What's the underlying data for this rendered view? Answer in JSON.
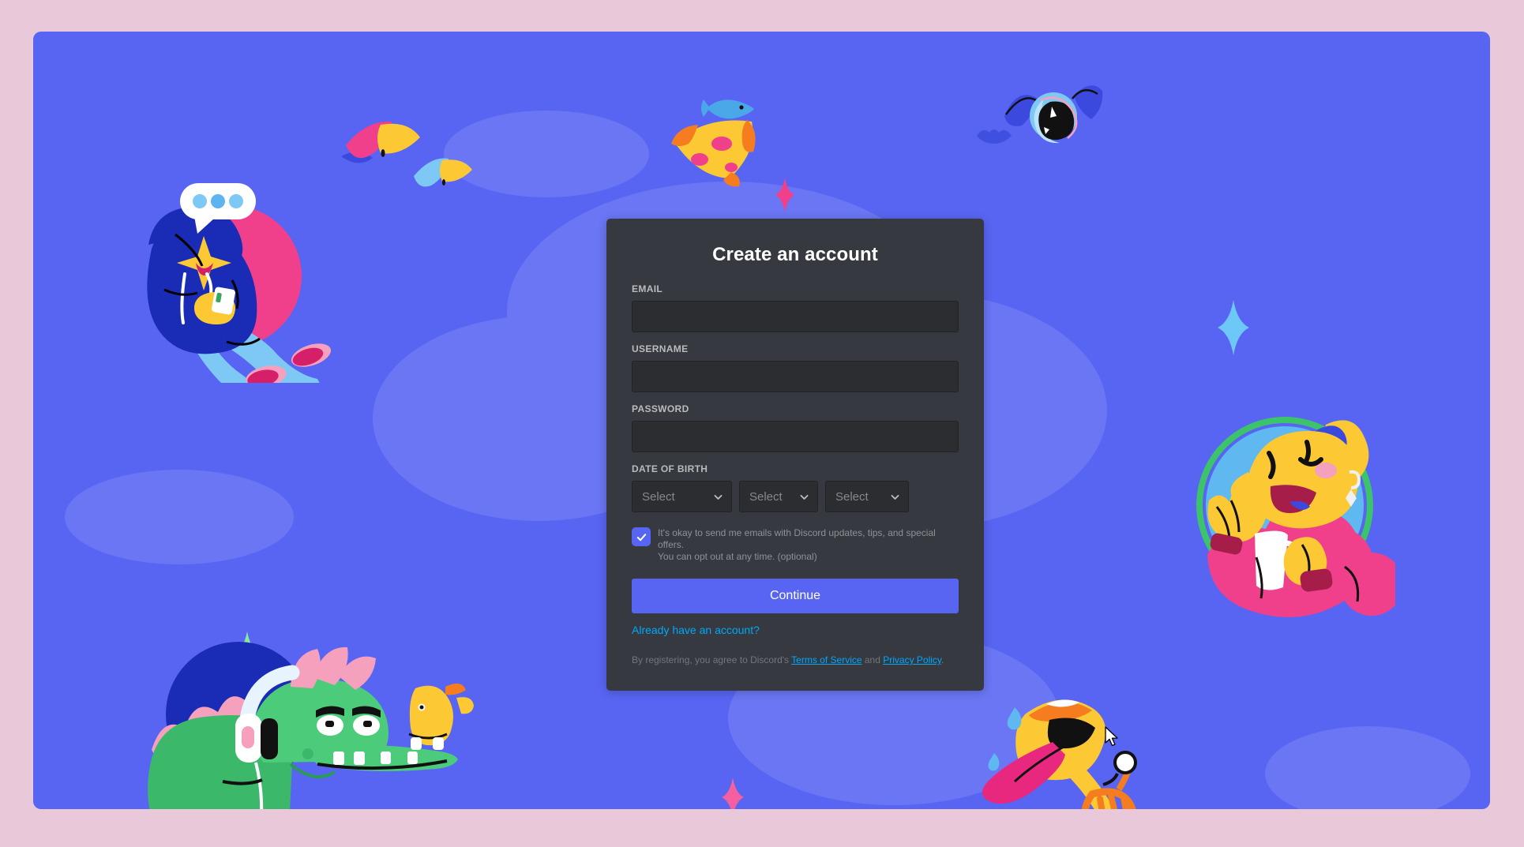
{
  "page": {
    "outer_background": "#e8c8d9",
    "panel_background": "#5865f2"
  },
  "card": {
    "title": "Create an account",
    "background": "#36393f",
    "fields": [
      {
        "label": "EMAIL",
        "value": "",
        "placeholder": "",
        "name": "email"
      },
      {
        "label": "USERNAME",
        "value": "",
        "placeholder": "",
        "name": "username"
      },
      {
        "label": "PASSWORD",
        "value": "",
        "placeholder": "",
        "name": "password"
      }
    ],
    "date_of_birth": {
      "label": "DATE OF BIRTH",
      "month": {
        "value": "Select",
        "placeholder": "Select"
      },
      "day": {
        "value": "Select",
        "placeholder": "Select"
      },
      "year": {
        "value": "Select",
        "placeholder": "Select"
      },
      "chevron_icon": "chevron-down-icon"
    },
    "optin": {
      "checked": true,
      "checkbox_color": "#5865f2",
      "check_icon": "checkmark-icon",
      "line1": "It's okay to send me emails with Discord updates, tips, and special offers.",
      "line2": "You can opt out at any time. (optional)"
    },
    "continue_button": {
      "label": "Continue",
      "color": "#5865f2"
    },
    "login_link": {
      "label": "Already have an account?",
      "color": "#00a8fc"
    },
    "terms": {
      "prefix": "By registering, you agree to Discord's ",
      "terms_link": "Terms of Service",
      "middle": " and ",
      "privacy_link": "Privacy Policy",
      "suffix": ".",
      "link_color": "#00a8fc"
    }
  },
  "illustrations": {
    "top_left_person": "person-on-phone-illustration",
    "chat_bubble": "chat-bubble-icon",
    "bottom_left_dino": "dinosaur-with-headphones-illustration",
    "right_character": "waving-character-illustration",
    "bottom_right_horn": "french-horn-illustration",
    "top_right_bat": "flying-bat-illustration",
    "birds": "flying-bird-illustration",
    "fish": "fish-illustration",
    "pizza": "pizza-slice-illustration",
    "sparkles": "sparkle-icon"
  },
  "cursor": {
    "name": "mouse-pointer"
  }
}
